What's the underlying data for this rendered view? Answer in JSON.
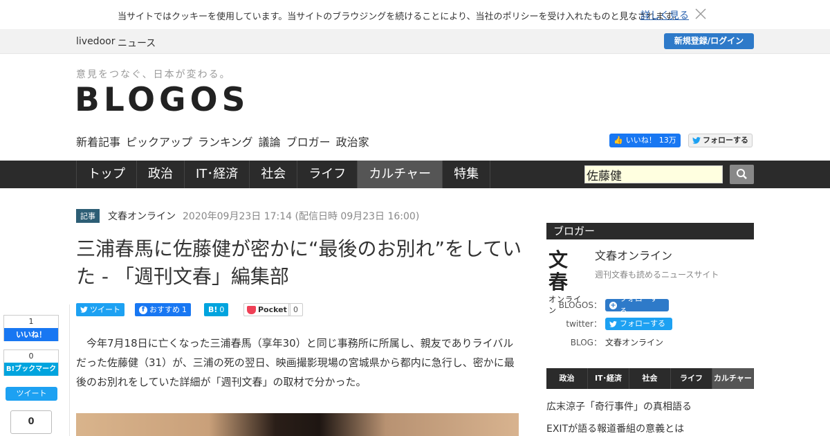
{
  "cookie": {
    "text": "当サイトではクッキーを使用しています。当サイトのブラウジングを続けることにより、当社のポリシーを受け入れたものと見なされます。",
    "more_link": "詳しく見る"
  },
  "topbar": {
    "brand": "livedoor",
    "brand_section": "ニュース",
    "login_button": "新規登録/ログイン"
  },
  "header": {
    "tagline": "意見をつなぐ、日本が変わる。",
    "logo": "BLOGOS",
    "subnav": [
      "新着記事",
      "ピックアップ",
      "ランキング",
      "議論",
      "ブロガー",
      "政治家"
    ],
    "like_label": "いいね！",
    "like_count": "13万",
    "follow_label": "フォローする"
  },
  "mainnav": {
    "items": [
      "トップ",
      "政治",
      "IT･経済",
      "社会",
      "ライフ",
      "カルチャー",
      "特集"
    ],
    "active_index": 5,
    "search_value": "佐藤健"
  },
  "article": {
    "tag": "記事",
    "source": "文春オンライン",
    "date": "2020年09月23日 17:14 (配信日時 09月23日 16:00)",
    "headline": "三浦春馬に佐藤健が密かに“最後のお別れ”をしていた - 「週刊文春」編集部",
    "body": "今年7月18日に亡くなった三浦春馬（享年30）と同じ事務所に所属し、親友でありライバルだった佐藤健（31）が、三浦の死の翌日、映画撮影現場の宮城県から都内に急行し、密かに最後のお別れをしていた詳細が「週刊文春」の取材で分かった。",
    "share": {
      "tweet": "ツイート",
      "fb": "おすすめ",
      "fb_count": "1",
      "hatena": "B!",
      "hatena_count": "0",
      "pocket": "Pocket",
      "pocket_count": "0"
    }
  },
  "float_share": {
    "like_count": "1",
    "like_label": "いいね！",
    "hatena_count": "0",
    "hatena_label": "B!ブックマーク",
    "tweet_label": "ツイート",
    "total_count": "0"
  },
  "sidebar": {
    "heading": "ブロガー",
    "logo_big": "文春",
    "logo_small": "オンライン",
    "name": "文春オンライン",
    "desc": "週刊文春も読めるニュースサイト",
    "blogos_label": "BLOGOS：",
    "blogos_follow": "フォローする",
    "twitter_label": "twitter：",
    "twitter_follow": "フォローする",
    "blog_label": "BLOG：",
    "blog_value": "文春オンライン",
    "tabs": [
      "政治",
      "IT･経済",
      "社会",
      "ライフ",
      "カルチャー"
    ],
    "active_tab": 4,
    "links": [
      "広末涼子「奇行事件」の真相語る",
      "EXITが語る報道番組の意義とは"
    ]
  },
  "colors": {
    "nav_bg": "#2b2b2b",
    "accent_blue": "#2e7ac9",
    "twitter": "#1da1f2",
    "facebook": "#1877f2",
    "hatena": "#00a4de"
  }
}
